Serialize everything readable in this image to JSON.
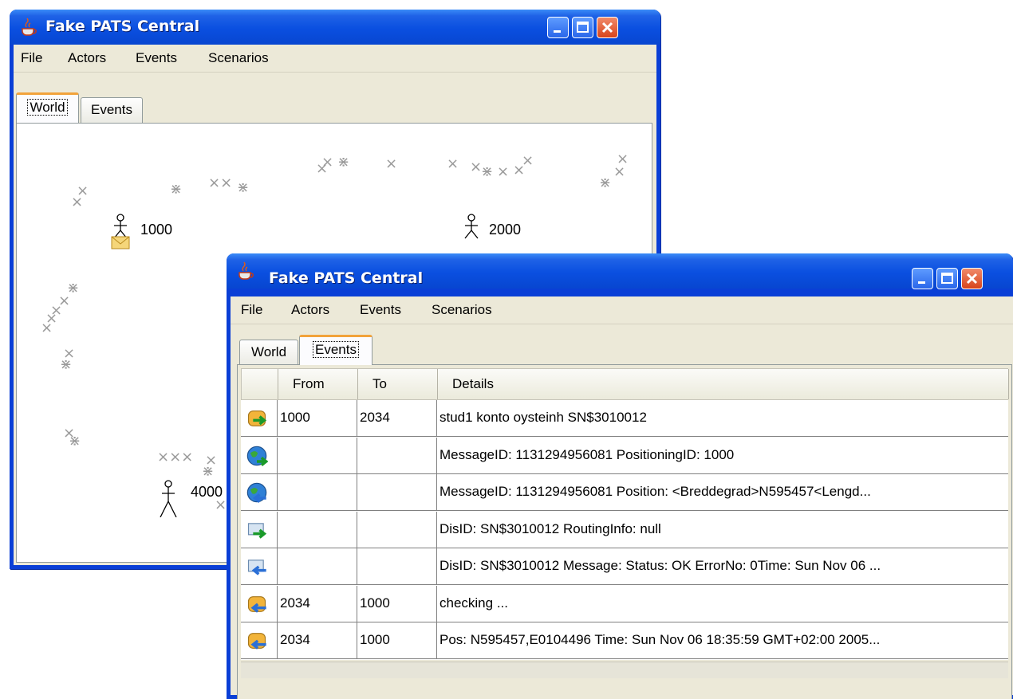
{
  "back_window": {
    "title": "Fake PATS Central",
    "menu": [
      "File",
      "Actors",
      "Events",
      "Scenarios"
    ],
    "tabs": [
      "World",
      "Events"
    ],
    "active_tab": "World",
    "actors": [
      {
        "label": "1000",
        "has_message": true
      },
      {
        "label": "2000",
        "has_message": false
      },
      {
        "label": "4000",
        "has_message": false
      }
    ]
  },
  "front_window": {
    "title": "Fake PATS Central",
    "menu": [
      "File",
      "Actors",
      "Events",
      "Scenarios"
    ],
    "tabs": [
      "World",
      "Events"
    ],
    "active_tab": "Events",
    "table": {
      "columns": [
        "",
        "From",
        "To",
        "Details"
      ],
      "rows": [
        {
          "icon": "phone-outgoing-icon",
          "from": "1000",
          "to": "2034",
          "details": "stud1 konto oysteinh SN$3010012"
        },
        {
          "icon": "globe-outgoing-icon",
          "from": "",
          "to": "",
          "details": "MessageID: 1131294956081 PositioningID: 1000"
        },
        {
          "icon": "globe-incoming-icon",
          "from": "",
          "to": "",
          "details": "MessageID: 1131294956081 Position: <Breddegrad>N595457<Lengd..."
        },
        {
          "icon": "dis-outgoing-icon",
          "from": "",
          "to": "",
          "details": "DisID: SN$3010012 RoutingInfo: null"
        },
        {
          "icon": "dis-incoming-icon",
          "from": "",
          "to": "",
          "details": "DisID: SN$3010012 Message: Status: OK ErrorNo: 0Time: Sun Nov 06 ..."
        },
        {
          "icon": "phone-incoming-icon",
          "from": "2034",
          "to": "1000",
          "details": "checking ..."
        },
        {
          "icon": "phone-incoming-icon",
          "from": "2034",
          "to": "1000",
          "details": "Pos: N595457,E0104496 Time: Sun Nov 06 18:35:59 GMT+02:00 2005..."
        }
      ]
    }
  },
  "colors": {
    "titlebar": "#0a4fe0",
    "window_face": "#ece9d8",
    "tab_highlight": "#f2a33b",
    "close_button": "#d8441c"
  }
}
